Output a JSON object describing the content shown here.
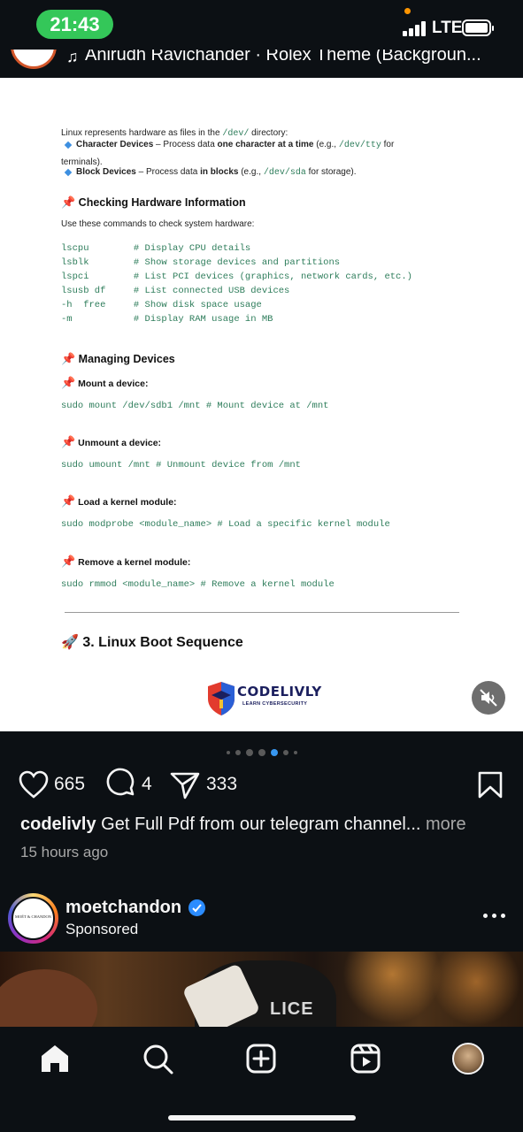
{
  "status_bar": {
    "time": "21:43",
    "network": "LTE"
  },
  "post_header": {
    "audio": "Anirudh Ravichander · Rolex Theme (Backgroun..."
  },
  "document": {
    "intro": {
      "line1_a": "Linux represents hardware as files in the ",
      "line1_code": "/dev/",
      "line1_b": " directory:",
      "char_label": "Character Devices",
      "char_mid": " – Process data ",
      "char_bold": "one character at a time",
      "char_paren": " (e.g., ",
      "char_code": "/dev/tty",
      "char_for": " for",
      "char_line2": "terminals).",
      "block_label": "Block Devices",
      "block_mid": " – Process data ",
      "block_bold": "in blocks",
      "block_paren": " (e.g., ",
      "block_code": "/dev/sda",
      "block_for": " for storage)."
    },
    "check_heading": "Checking Hardware Information",
    "check_desc": "Use these commands to check system hardware:",
    "check_code": [
      "lscpu        # Display CPU details",
      "lsblk        # Show storage devices and partitions",
      "lspci        # List PCI devices (graphics, network cards, etc.)",
      "lsusb df     # List connected USB devices",
      "-h  free     # Show disk space usage",
      "-m           # Display RAM usage in MB"
    ],
    "manage_heading": "Managing Devices",
    "mount_heading": "Mount a device:",
    "mount_code": "sudo mount /dev/sdb1 /mnt # Mount device at /mnt",
    "unmount_heading": "Unmount a device:",
    "unmount_code": "sudo umount /mnt # Unmount device from /mnt",
    "load_heading": "Load a kernel module:",
    "load_code": "sudo modprobe <module_name> # Load a specific kernel module",
    "remove_heading": "Remove a kernel module:",
    "remove_code": "sudo rmmod <module_name> # Remove a kernel module",
    "boot_heading": "3. Linux Boot Sequence",
    "brand_name": "CODELIVLY",
    "brand_tagline": "LEARN CYBERSECURITY"
  },
  "actions": {
    "likes": "665",
    "comments": "4",
    "shares": "333"
  },
  "caption": {
    "username": "codelivly",
    "text": " Get Full Pdf from our telegram channel...",
    "more": " more",
    "time_ago": "15 hours ago"
  },
  "sponsored": {
    "username": "moetchandon",
    "label": "Sponsored",
    "avatar_text": "MOËT & CHANDON",
    "image_text": "LICE"
  },
  "icons": {
    "like": "heart-icon",
    "comment": "comment-icon",
    "share": "send-icon",
    "save": "bookmark-icon",
    "mute": "sound-off-icon",
    "home": "home-icon",
    "search": "search-icon",
    "create": "plus-square-icon",
    "reels": "reels-icon"
  },
  "colors": {
    "accent_green": "#34c759",
    "verified_blue": "#2b8cff",
    "code_green": "#2e7d5b"
  }
}
